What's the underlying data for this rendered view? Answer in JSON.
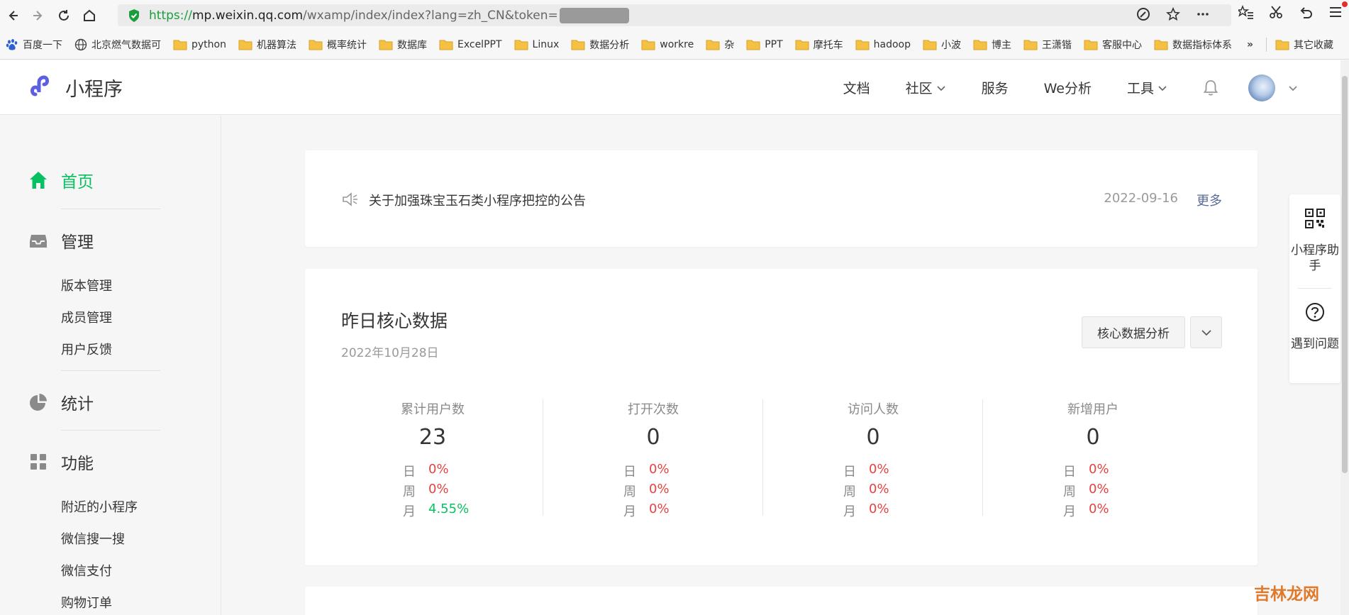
{
  "browser": {
    "url_https": "https://",
    "url_host": "mp.weixin.qq.com",
    "url_rest": "/wxamp/index/index?lang=zh_CN&token=",
    "bookmarks": [
      "百度一下",
      "北京燃气数据可",
      "python",
      "机器算法",
      "概率统计",
      "数据库",
      "ExcelPPT",
      "Linux",
      "数据分析",
      "workre",
      "杂",
      "PPT",
      "摩托车",
      "hadoop",
      "小波",
      "博主",
      "王潇锴",
      "客服中心",
      "数据指标体系"
    ],
    "bookmarks_more": "»",
    "other_bookmarks": "其它收藏"
  },
  "header": {
    "logo_text": "小程序",
    "nav": [
      "文档",
      "社区",
      "服务",
      "We分析",
      "工具"
    ]
  },
  "sidebar": {
    "home": "首页",
    "manage": "管理",
    "manage_items": [
      "版本管理",
      "成员管理",
      "用户反馈"
    ],
    "stats": "统计",
    "features": "功能",
    "feature_items": [
      "附近的小程序",
      "微信搜一搜",
      "微信支付",
      "购物订单"
    ]
  },
  "notice": {
    "text": "关于加强珠宝玉石类小程序把控的公告",
    "date": "2022-09-16",
    "more": "更多"
  },
  "core": {
    "title": "昨日核心数据",
    "date": "2022年10月28日",
    "button": "核心数据分析",
    "period_labels": [
      "日",
      "周",
      "月"
    ],
    "stats": [
      {
        "label": "累计用户数",
        "value": "23",
        "day": "0%",
        "week": "0%",
        "month": "4.55%"
      },
      {
        "label": "打开次数",
        "value": "0",
        "day": "0%",
        "week": "0%",
        "month": "0%"
      },
      {
        "label": "访问人数",
        "value": "0",
        "day": "0%",
        "week": "0%",
        "month": "0%"
      },
      {
        "label": "新增用户",
        "value": "0",
        "day": "0%",
        "week": "0%",
        "month": "0%"
      }
    ]
  },
  "helper": {
    "assistant": "小程序助手",
    "problem": "遇到问题"
  },
  "watermark": "吉林龙网",
  "colors": {
    "accent": "#07c160",
    "link": "#576b95",
    "negative": "#e64340"
  }
}
